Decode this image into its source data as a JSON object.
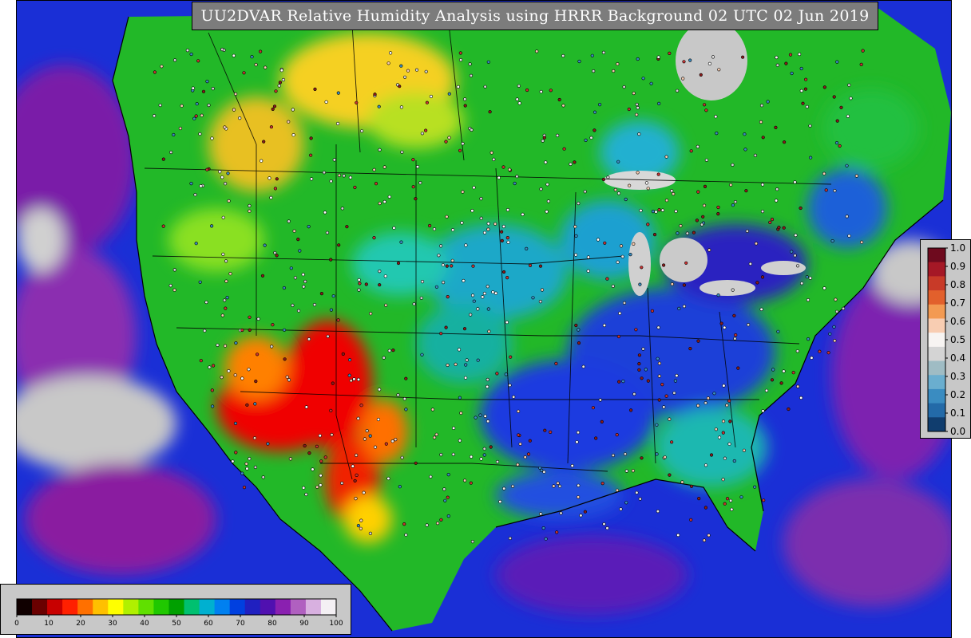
{
  "title": "UU2DVAR Relative Humidity Analysis using HRRR Background 02 UTC 02 Jun 2019",
  "colors": {
    "title_bg": "#7c7c7c",
    "legend_bg": "#c8c8c8",
    "ocean_deep": "#1530d8",
    "ocean_purple": "#7b1fa2",
    "land_green": "#22c222",
    "dry_red": "#f00000",
    "lake_gray": "#c8c8c8"
  },
  "rh_legend": {
    "labels": [
      "0",
      "10",
      "20",
      "30",
      "40",
      "50",
      "60",
      "70",
      "80",
      "90",
      "100"
    ],
    "colors": [
      "#100000",
      "#6a0000",
      "#c80000",
      "#ff2000",
      "#ff7000",
      "#ffc000",
      "#ffff00",
      "#b0f000",
      "#60e000",
      "#20c800",
      "#00a000",
      "#00c070",
      "#00b0d0",
      "#0080f0",
      "#0040e0",
      "#2020c0",
      "#5010b0",
      "#8a20b0",
      "#b060c0",
      "#d8b0e0",
      "#f4f0f4"
    ]
  },
  "cov_legend": {
    "labels": [
      "1.0",
      "0.9",
      "0.8",
      "0.7",
      "0.6",
      "0.5",
      "0.4",
      "0.3",
      "0.2",
      "0.1",
      "0.0"
    ],
    "colors": [
      "#6e0a1e",
      "#a51826",
      "#c83a28",
      "#e2602c",
      "#f39a52",
      "#f8cdb2",
      "#f7f4f2",
      "#d4d4d4",
      "#9fbcc4",
      "#6aaecf",
      "#3a8cc1",
      "#236aa8",
      "#103d6e"
    ]
  }
}
